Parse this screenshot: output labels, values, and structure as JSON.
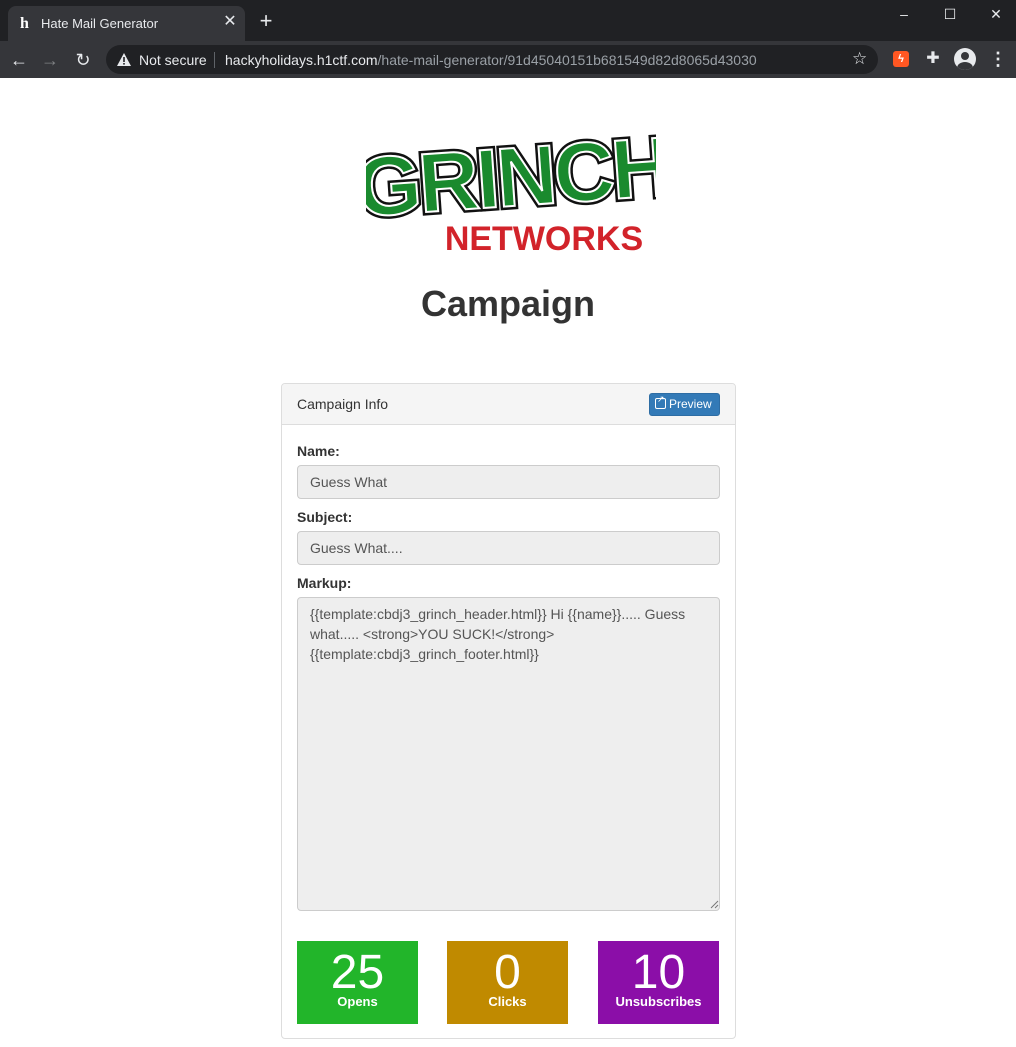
{
  "browser": {
    "tab_title": "Hate Mail Generator",
    "favicon_glyph": "h",
    "security_text": "Not secure",
    "url_host": "hackyholidays.h1ctf.com",
    "url_path": "/hate-mail-generator/91d45040151b681549d82d8065d43030"
  },
  "logo": {
    "top_text": "GRINCH",
    "bottom_text": "NETWORKS",
    "colors": {
      "green": "#1a8a2e",
      "outline": "#111111",
      "red": "#d2232a"
    }
  },
  "page": {
    "title": "Campaign"
  },
  "panel": {
    "heading": "Campaign Info",
    "preview_label": "Preview",
    "name_label": "Name:",
    "name_value": "Guess What",
    "subject_label": "Subject:",
    "subject_value": "Guess What....",
    "markup_label": "Markup:",
    "markup_value": "{{template:cbdj3_grinch_header.html}} Hi {{name}}..... Guess what..... <strong>YOU SUCK!</strong> {{template:cbdj3_grinch_footer.html}}"
  },
  "stats": [
    {
      "value": "25",
      "label": "Opens",
      "color": "#22b52a"
    },
    {
      "value": "0",
      "label": "Clicks",
      "color": "#c08a00"
    },
    {
      "value": "10",
      "label": "Unsubscribes",
      "color": "#8b0ea8"
    }
  ]
}
